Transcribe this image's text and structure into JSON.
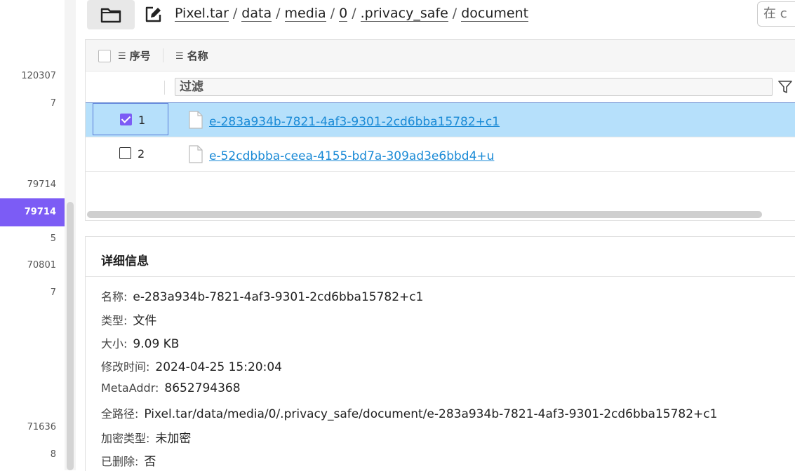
{
  "left_numbers": [
    {
      "text": "120307",
      "selected": false
    },
    {
      "text": "7",
      "selected": false
    },
    {
      "text": "79714",
      "selected": false
    },
    {
      "text": "79714",
      "selected": true
    },
    {
      "text": "5",
      "selected": false
    },
    {
      "text": "70801",
      "selected": false
    },
    {
      "text": "7",
      "selected": false
    },
    {
      "text": "71636",
      "selected": false
    },
    {
      "text": "8",
      "selected": false
    }
  ],
  "toolbar": {
    "breadcrumb": [
      "Pixel.tar",
      "data",
      "media",
      "0",
      ".privacy_safe",
      "document"
    ],
    "breadcrumb_sep": "/",
    "search_placeholder": "在 c"
  },
  "table": {
    "header_index": "序号",
    "header_name": "名称",
    "filter_label": "过滤",
    "rows": [
      {
        "index": "1",
        "name": "e-283a934b-7821-4af3-9301-2cd6bba15782+c1",
        "checked": true,
        "selected": true
      },
      {
        "index": "2",
        "name": "e-52cdbbba-ceea-4155-bd7a-309ad3e6bbd4+u",
        "checked": false,
        "selected": false
      }
    ]
  },
  "details": {
    "title": "详细信息",
    "fields": [
      {
        "key": "名称:",
        "value": "e-283a934b-7821-4af3-9301-2cd6bba15782+c1"
      },
      {
        "key": "类型:",
        "value": "文件"
      },
      {
        "key": "大小:",
        "value": "9.09 KB"
      },
      {
        "key": "修改时间:",
        "value": "2024-04-25 15:20:04"
      },
      {
        "key": "MetaAddr:",
        "value": "8652794368"
      },
      {
        "key": "全路径:",
        "value": "Pixel.tar/data/media/0/.privacy_safe/document/e-283a934b-7821-4af3-9301-2cd6bba15782+c1"
      },
      {
        "key": "加密类型:",
        "value": "未加密"
      },
      {
        "key": "已删除:",
        "value": "否"
      }
    ]
  },
  "colors": {
    "accent": "#7c5cf5",
    "selected_row": "#b6e0fb",
    "link": "#1a8ad6"
  }
}
